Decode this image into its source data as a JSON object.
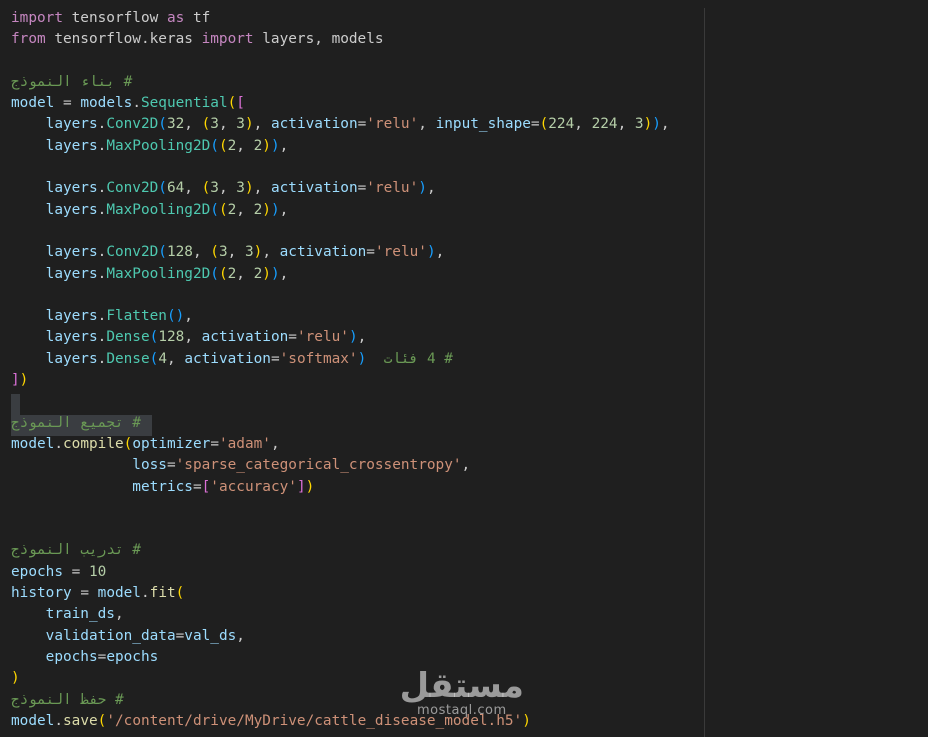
{
  "lines": [
    {
      "tokens": [
        [
          "kw",
          "import"
        ],
        [
          "tx",
          " tensorflow "
        ],
        [
          "kw",
          "as"
        ],
        [
          "tx",
          " tf"
        ]
      ]
    },
    {
      "tokens": [
        [
          "kw",
          "from"
        ],
        [
          "tx",
          " tensorflow.keras "
        ],
        [
          "kw",
          "import"
        ],
        [
          "tx",
          " layers, models"
        ]
      ]
    },
    {
      "tokens": []
    },
    {
      "tokens": [
        [
          "cm",
          "# بناء النموذج"
        ]
      ]
    },
    {
      "tokens": [
        [
          "vr",
          "model"
        ],
        [
          "tx",
          " = "
        ],
        [
          "vr",
          "models"
        ],
        [
          "tx",
          "."
        ],
        [
          "cl",
          "Sequential"
        ],
        [
          "pa",
          "("
        ],
        [
          "pb",
          "["
        ]
      ]
    },
    {
      "tokens": [
        [
          "tx",
          "    "
        ],
        [
          "vr",
          "layers"
        ],
        [
          "tx",
          "."
        ],
        [
          "cl",
          "Conv2D"
        ],
        [
          "pc",
          "("
        ],
        [
          "nu",
          "32"
        ],
        [
          "tx",
          ", "
        ],
        [
          "pa",
          "("
        ],
        [
          "nu",
          "3"
        ],
        [
          "tx",
          ", "
        ],
        [
          "nu",
          "3"
        ],
        [
          "pa",
          ")"
        ],
        [
          "tx",
          ", "
        ],
        [
          "vr",
          "activation"
        ],
        [
          "tx",
          "="
        ],
        [
          "st",
          "'relu'"
        ],
        [
          "tx",
          ", "
        ],
        [
          "vr",
          "input_shape"
        ],
        [
          "tx",
          "="
        ],
        [
          "pa",
          "("
        ],
        [
          "nu",
          "224"
        ],
        [
          "tx",
          ", "
        ],
        [
          "nu",
          "224"
        ],
        [
          "tx",
          ", "
        ],
        [
          "nu",
          "3"
        ],
        [
          "pa",
          ")"
        ],
        [
          "pc",
          ")"
        ],
        [
          "tx",
          ","
        ]
      ]
    },
    {
      "tokens": [
        [
          "tx",
          "    "
        ],
        [
          "vr",
          "layers"
        ],
        [
          "tx",
          "."
        ],
        [
          "cl",
          "MaxPooling2D"
        ],
        [
          "pc",
          "("
        ],
        [
          "pa",
          "("
        ],
        [
          "nu",
          "2"
        ],
        [
          "tx",
          ", "
        ],
        [
          "nu",
          "2"
        ],
        [
          "pa",
          ")"
        ],
        [
          "pc",
          ")"
        ],
        [
          "tx",
          ","
        ]
      ]
    },
    {
      "tokens": []
    },
    {
      "tokens": [
        [
          "tx",
          "    "
        ],
        [
          "vr",
          "layers"
        ],
        [
          "tx",
          "."
        ],
        [
          "cl",
          "Conv2D"
        ],
        [
          "pc",
          "("
        ],
        [
          "nu",
          "64"
        ],
        [
          "tx",
          ", "
        ],
        [
          "pa",
          "("
        ],
        [
          "nu",
          "3"
        ],
        [
          "tx",
          ", "
        ],
        [
          "nu",
          "3"
        ],
        [
          "pa",
          ")"
        ],
        [
          "tx",
          ", "
        ],
        [
          "vr",
          "activation"
        ],
        [
          "tx",
          "="
        ],
        [
          "st",
          "'relu'"
        ],
        [
          "pc",
          ")"
        ],
        [
          "tx",
          ","
        ]
      ]
    },
    {
      "tokens": [
        [
          "tx",
          "    "
        ],
        [
          "vr",
          "layers"
        ],
        [
          "tx",
          "."
        ],
        [
          "cl",
          "MaxPooling2D"
        ],
        [
          "pc",
          "("
        ],
        [
          "pa",
          "("
        ],
        [
          "nu",
          "2"
        ],
        [
          "tx",
          ", "
        ],
        [
          "nu",
          "2"
        ],
        [
          "pa",
          ")"
        ],
        [
          "pc",
          ")"
        ],
        [
          "tx",
          ","
        ]
      ]
    },
    {
      "tokens": []
    },
    {
      "tokens": [
        [
          "tx",
          "    "
        ],
        [
          "vr",
          "layers"
        ],
        [
          "tx",
          "."
        ],
        [
          "cl",
          "Conv2D"
        ],
        [
          "pc",
          "("
        ],
        [
          "nu",
          "128"
        ],
        [
          "tx",
          ", "
        ],
        [
          "pa",
          "("
        ],
        [
          "nu",
          "3"
        ],
        [
          "tx",
          ", "
        ],
        [
          "nu",
          "3"
        ],
        [
          "pa",
          ")"
        ],
        [
          "tx",
          ", "
        ],
        [
          "vr",
          "activation"
        ],
        [
          "tx",
          "="
        ],
        [
          "st",
          "'relu'"
        ],
        [
          "pc",
          ")"
        ],
        [
          "tx",
          ","
        ]
      ]
    },
    {
      "tokens": [
        [
          "tx",
          "    "
        ],
        [
          "vr",
          "layers"
        ],
        [
          "tx",
          "."
        ],
        [
          "cl",
          "MaxPooling2D"
        ],
        [
          "pc",
          "("
        ],
        [
          "pa",
          "("
        ],
        [
          "nu",
          "2"
        ],
        [
          "tx",
          ", "
        ],
        [
          "nu",
          "2"
        ],
        [
          "pa",
          ")"
        ],
        [
          "pc",
          ")"
        ],
        [
          "tx",
          ","
        ]
      ]
    },
    {
      "tokens": []
    },
    {
      "tokens": [
        [
          "tx",
          "    "
        ],
        [
          "vr",
          "layers"
        ],
        [
          "tx",
          "."
        ],
        [
          "cl",
          "Flatten"
        ],
        [
          "pc",
          "()"
        ],
        [
          "tx",
          ","
        ]
      ]
    },
    {
      "tokens": [
        [
          "tx",
          "    "
        ],
        [
          "vr",
          "layers"
        ],
        [
          "tx",
          "."
        ],
        [
          "cl",
          "Dense"
        ],
        [
          "pc",
          "("
        ],
        [
          "nu",
          "128"
        ],
        [
          "tx",
          ", "
        ],
        [
          "vr",
          "activation"
        ],
        [
          "tx",
          "="
        ],
        [
          "st",
          "'relu'"
        ],
        [
          "pc",
          ")"
        ],
        [
          "tx",
          ","
        ]
      ]
    },
    {
      "tokens": [
        [
          "tx",
          "    "
        ],
        [
          "vr",
          "layers"
        ],
        [
          "tx",
          "."
        ],
        [
          "cl",
          "Dense"
        ],
        [
          "pc",
          "("
        ],
        [
          "nu",
          "4"
        ],
        [
          "tx",
          ", "
        ],
        [
          "vr",
          "activation"
        ],
        [
          "tx",
          "="
        ],
        [
          "st",
          "'softmax'"
        ],
        [
          "pc",
          ")"
        ],
        [
          "tx",
          "  "
        ],
        [
          "cm",
          "# 4 فئات"
        ]
      ]
    },
    {
      "tokens": [
        [
          "pb",
          "]"
        ],
        [
          "pa",
          ")"
        ]
      ]
    },
    {
      "tokens": []
    },
    {
      "tokens": [
        [
          "cm",
          "# تجميع النموذج"
        ]
      ]
    },
    {
      "tokens": [
        [
          "vr",
          "model"
        ],
        [
          "tx",
          "."
        ],
        [
          "fn",
          "compile"
        ],
        [
          "pa",
          "("
        ],
        [
          "vr",
          "optimizer"
        ],
        [
          "tx",
          "="
        ],
        [
          "st",
          "'adam'"
        ],
        [
          "tx",
          ","
        ]
      ]
    },
    {
      "tokens": [
        [
          "tx",
          "              "
        ],
        [
          "vr",
          "loss"
        ],
        [
          "tx",
          "="
        ],
        [
          "st",
          "'sparse_categorical_crossentropy'"
        ],
        [
          "tx",
          ","
        ]
      ]
    },
    {
      "tokens": [
        [
          "tx",
          "              "
        ],
        [
          "vr",
          "metrics"
        ],
        [
          "tx",
          "="
        ],
        [
          "pb",
          "["
        ],
        [
          "st",
          "'accuracy'"
        ],
        [
          "pb",
          "]"
        ],
        [
          "pa",
          ")"
        ]
      ]
    },
    {
      "tokens": []
    },
    {
      "tokens": []
    },
    {
      "tokens": [
        [
          "cm",
          "# تدريب النموذج"
        ]
      ]
    },
    {
      "tokens": [
        [
          "vr",
          "epochs"
        ],
        [
          "tx",
          " = "
        ],
        [
          "nu",
          "10"
        ]
      ]
    },
    {
      "tokens": [
        [
          "vr",
          "history"
        ],
        [
          "tx",
          " = "
        ],
        [
          "vr",
          "model"
        ],
        [
          "tx",
          "."
        ],
        [
          "fn",
          "fit"
        ],
        [
          "pa",
          "("
        ]
      ]
    },
    {
      "tokens": [
        [
          "tx",
          "    "
        ],
        [
          "vr",
          "train_ds"
        ],
        [
          "tx",
          ","
        ]
      ]
    },
    {
      "tokens": [
        [
          "tx",
          "    "
        ],
        [
          "vr",
          "validation_data"
        ],
        [
          "tx",
          "="
        ],
        [
          "vr",
          "val_ds"
        ],
        [
          "tx",
          ","
        ]
      ]
    },
    {
      "tokens": [
        [
          "tx",
          "    "
        ],
        [
          "vr",
          "epochs"
        ],
        [
          "tx",
          "="
        ],
        [
          "vr",
          "epochs"
        ]
      ]
    },
    {
      "tokens": [
        [
          "pa",
          ")"
        ]
      ]
    },
    {
      "tokens": [
        [
          "cm",
          "# حفظ النموذج"
        ]
      ]
    },
    {
      "tokens": [
        [
          "vr",
          "model"
        ],
        [
          "tx",
          "."
        ],
        [
          "fn",
          "save"
        ],
        [
          "pa",
          "("
        ],
        [
          "st",
          "'/content/drive/MyDrive/cattle_disease_model.h5'"
        ],
        [
          "pa",
          ")"
        ]
      ]
    }
  ],
  "watermark": {
    "main": "مستقل",
    "sub": "mostaql.com"
  }
}
